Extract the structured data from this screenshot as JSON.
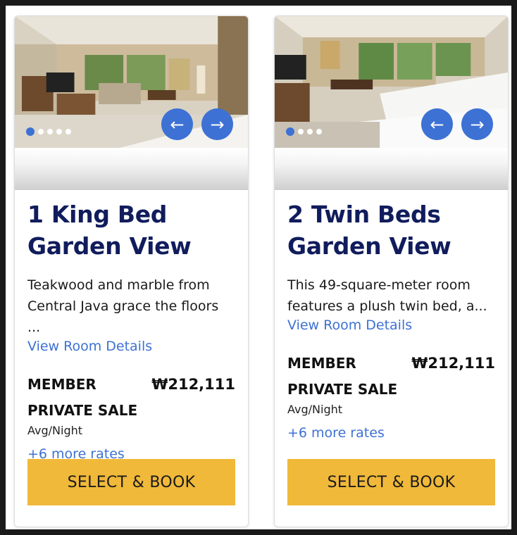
{
  "rooms": [
    {
      "title_line1": "1 King Bed",
      "title_line2": "Garden View",
      "desc_line1": "Teakwood and marble from",
      "desc_line2": "Central Java grace the floors ...",
      "details_link": "View Room Details",
      "rate_name": "MEMBER PRIVATE SALE",
      "price": "₩212,111",
      "avg_label": "Avg/Night",
      "more_rates": "+6 more rates",
      "book_label": "SELECT & BOOK",
      "prev_arrow": "←",
      "next_arrow": "→",
      "carousel_dots": 5,
      "active_dot": 1
    },
    {
      "title_line1": "2 Twin Beds",
      "title_line2": "Garden View",
      "desc_line1": "This 49-square-meter room",
      "desc_line2": "features a plush twin bed, a...",
      "details_link": "View Room Details",
      "rate_name": "MEMBER PRIVATE SALE",
      "price": "₩212,111",
      "avg_label": "Avg/Night",
      "more_rates": "+6 more rates",
      "book_label": "SELECT & BOOK",
      "prev_arrow": "←",
      "next_arrow": "→",
      "carousel_dots": 4,
      "active_dot": 1
    }
  ],
  "colors": {
    "accent_blue": "#3d71d4",
    "title_navy": "#101c5c",
    "book_button": "#f0b93a"
  }
}
